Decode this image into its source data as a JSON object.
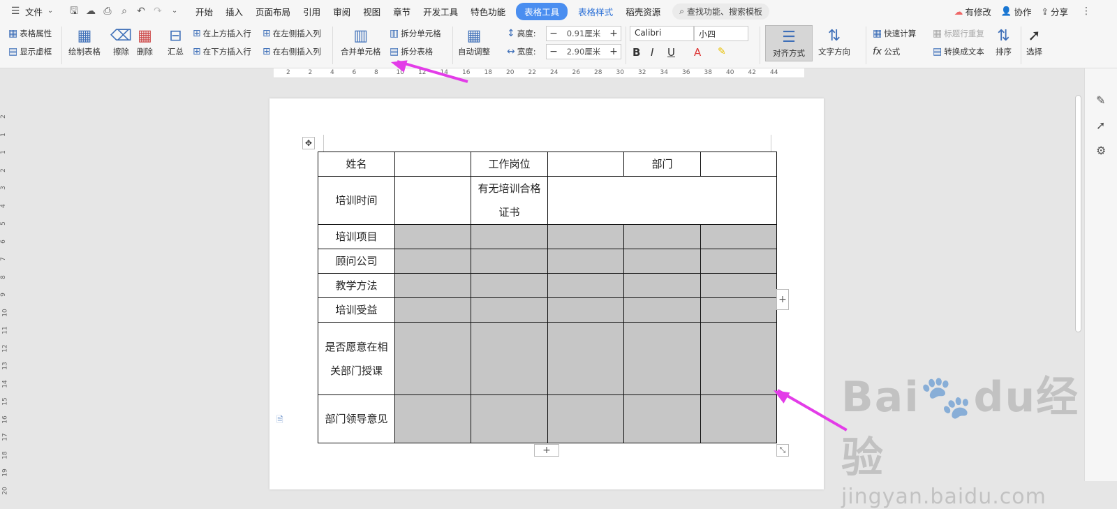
{
  "menubar": {
    "file_label": "文件",
    "tabs": [
      "开始",
      "插入",
      "页面布局",
      "引用",
      "审阅",
      "视图",
      "章节",
      "开发工具",
      "特色功能"
    ],
    "active_tab": "表格工具",
    "extra_tabs": [
      "表格样式",
      "稻壳资源"
    ],
    "search_placeholder": "查找功能、搜索模板",
    "right": {
      "modified": "有修改",
      "collab": "协作",
      "share": "分享"
    }
  },
  "ribbon": {
    "table_props": "表格属性",
    "show_grid": "显示虚框",
    "draw_table": "绘制表格",
    "erase": "擦除",
    "delete": "删除",
    "summary": "汇总",
    "insert_above": "在上方插入行",
    "insert_below": "在下方插入行",
    "insert_left": "在左侧插入列",
    "insert_right": "在右侧插入列",
    "merge_cells": "合并单元格",
    "split_cells": "拆分单元格",
    "split_table": "拆分表格",
    "auto_adjust": "自动调整",
    "height_label": "高度:",
    "height_value": "0.91厘米",
    "width_label": "宽度:",
    "width_value": "2.90厘米",
    "font_name": "Calibri",
    "font_size": "小四",
    "align": "对齐方式",
    "text_dir": "文字方向",
    "quick_calc": "快速计算",
    "repeat_header": "标题行重复",
    "formula": "公式",
    "to_text": "转换成文本",
    "sort": "排序",
    "select": "选择"
  },
  "ruler": {
    "top_ticks": [
      "2",
      "2",
      "4",
      "6",
      "8",
      "10",
      "12",
      "14",
      "16",
      "18",
      "20",
      "22",
      "24",
      "26",
      "28",
      "30",
      "32",
      "34",
      "36",
      "38",
      "40",
      "42",
      "44"
    ],
    "left_ticks": [
      "2",
      "1",
      "1",
      "2",
      "3",
      "4",
      "5",
      "6",
      "7",
      "8",
      "9",
      "10",
      "11",
      "12",
      "13",
      "14",
      "15",
      "16",
      "17",
      "18",
      "19",
      "20"
    ]
  },
  "table": {
    "row1": [
      "姓名",
      "",
      "工作岗位",
      "",
      "部门",
      ""
    ],
    "row2": [
      "培训时间",
      "",
      "有无培训合格证书",
      ""
    ],
    "rows": [
      "培训项目",
      "顾问公司",
      "教学方法",
      "培训受益",
      "是否愿意在相关部门授课",
      "部门领导意见"
    ]
  },
  "watermark": {
    "logo": "Bai🐾du经验",
    "url": "jingyan.baidu.com"
  },
  "colors": {
    "accent": "#4a8ef0",
    "arrow": "#e33ce8",
    "shaded_cell": "#c6c6c6"
  }
}
